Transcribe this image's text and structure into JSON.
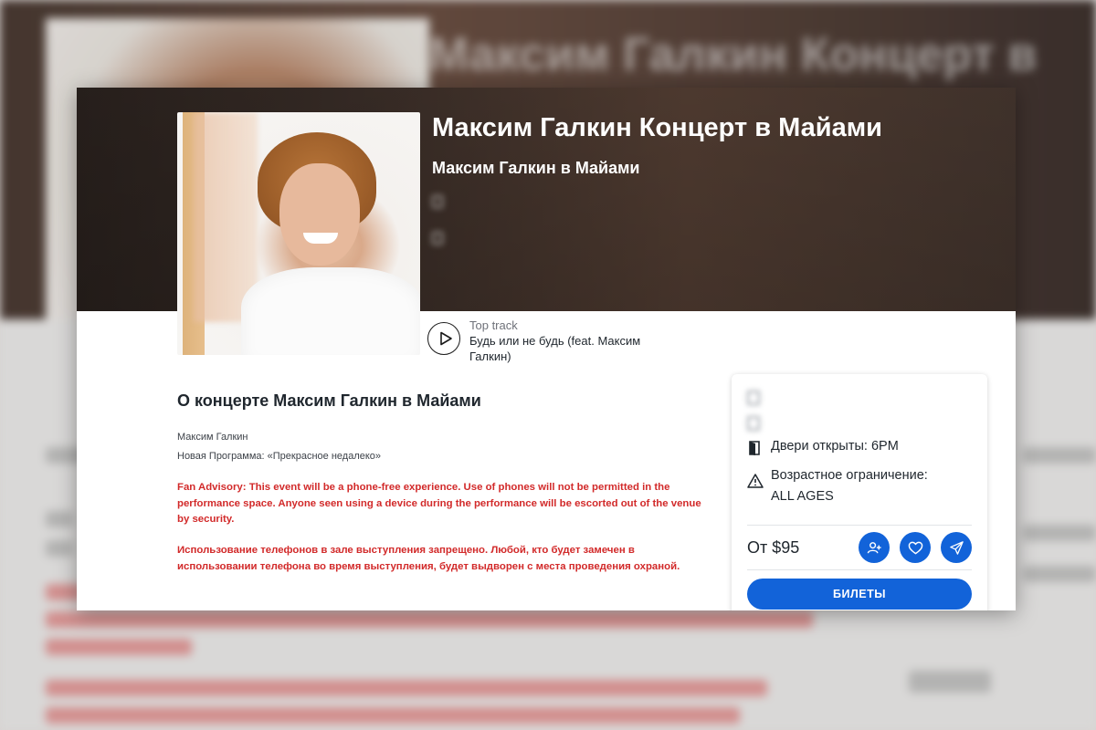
{
  "event": {
    "title": "Максим Галкин Концерт в Майами",
    "subtitle": "Максим Галкин в Майами"
  },
  "top_track": {
    "label": "Top track",
    "name": "Будь или не будь (feat. Максим Галкин)"
  },
  "about": {
    "title": "О концерте Максим Галкин в Майами",
    "artist": "Максим Галкин",
    "program": "Новая Программа: «Прекрасное недалеко»",
    "advisory_en": "Fan Advisory: This event will be a phone-free experience. Use of phones will not be permitted in the performance space. Anyone seen using a device during the performance will be escorted out of the venue by security.",
    "advisory_ru": "Использование телефонов в зале выступления запрещено. Любой, кто будет замечен в использовании телефона во время выступления, будет выдворен с места проведения охраной."
  },
  "panel": {
    "doors": "Двери открыты: 6PM",
    "age_restriction": "Возрастное ограничение: ALL AGES",
    "price": "От $95",
    "tickets_button": "БИЛЕТЫ"
  },
  "colors": {
    "accent": "#1263d9",
    "advisory_text": "#d22a2a",
    "hero_background": "#3d302a"
  },
  "icons": [
    "play-icon",
    "door-icon",
    "warning-icon",
    "add-person-icon",
    "heart-icon",
    "send-icon"
  ]
}
